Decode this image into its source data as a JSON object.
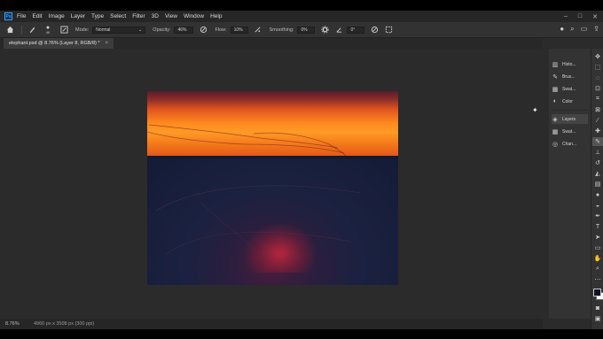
{
  "app": {
    "logo_text": "Ps"
  },
  "menu": [
    "File",
    "Edit",
    "Image",
    "Layer",
    "Type",
    "Select",
    "Filter",
    "3D",
    "View",
    "Window",
    "Help"
  ],
  "window_controls": [
    "–",
    "□",
    "✕"
  ],
  "options_bar": {
    "mode_label": "Mode:",
    "mode_value": "Normal",
    "opacity_label": "Opacity:",
    "opacity_value": "46%",
    "flow_label": "Flow:",
    "flow_value": "10%",
    "smoothing_label": "Smoothing:",
    "smoothing_value": "0%",
    "angle_value": "0°",
    "brush_size": "40"
  },
  "document": {
    "tab_title": "elephant.psd @ 8.76% (Layer 8, RGB/8) *",
    "tab_close": "×"
  },
  "status": {
    "zoom": "8.76%",
    "doc_info": "4960 px x 3508 px (300 ppi)"
  },
  "panels": [
    {
      "label": "Histo...",
      "icon": "histogram-icon"
    },
    {
      "label": "Brus...",
      "icon": "brushes-icon"
    },
    {
      "label": "Swat...",
      "icon": "swatches-icon"
    },
    {
      "label": "Color",
      "icon": "color-icon"
    },
    {
      "label": "Layers",
      "icon": "layers-icon"
    },
    {
      "label": "Swat...",
      "icon": "swatches-icon"
    },
    {
      "label": "Chan...",
      "icon": "channels-icon"
    }
  ],
  "colors": {
    "accent": "#31a8ff",
    "foreground": "#0e1226",
    "background": "#ffffff"
  }
}
